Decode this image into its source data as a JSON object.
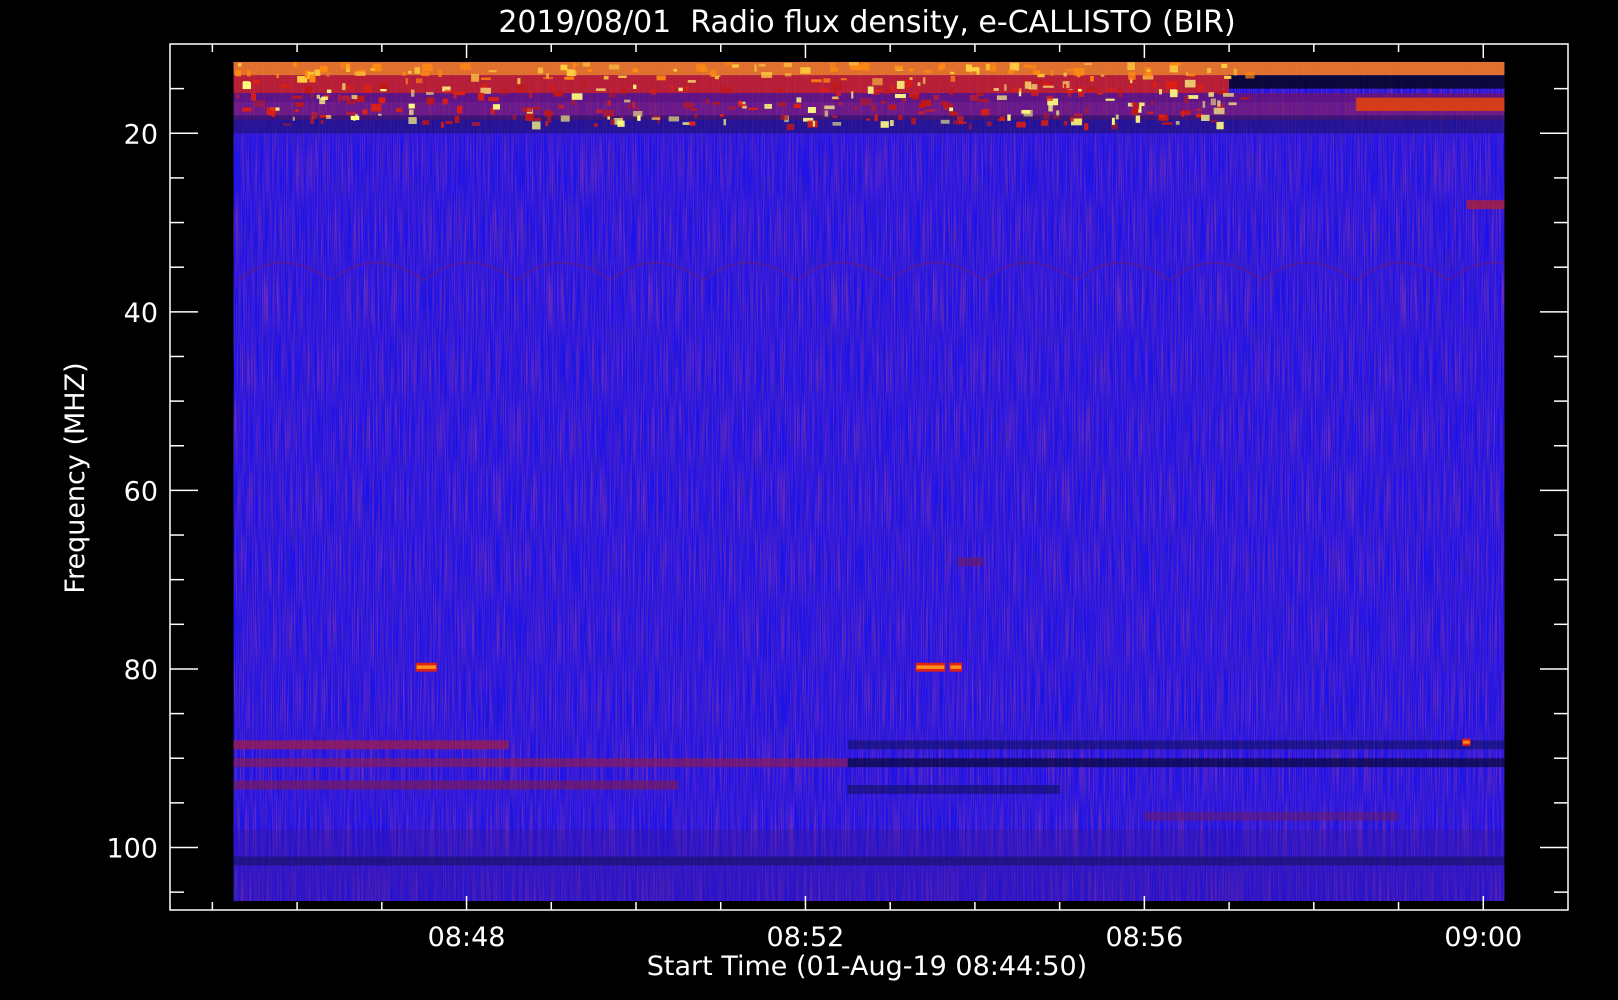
{
  "chart_data": {
    "type": "heatmap",
    "title": "2019/08/01  Radio flux density, e-CALLISTO (BIR)",
    "xlabel": "Start Time (01-Aug-19 08:44:50)",
    "ylabel": "Frequency (MHZ)",
    "x_ticks": [
      "08:48",
      "08:52",
      "08:56",
      "09:00"
    ],
    "y_ticks": [
      "20",
      "40",
      "60",
      "80",
      "100"
    ],
    "x_range_minutes": [
      44.5,
      61.0
    ],
    "data_range_minutes": [
      45.25,
      60.25
    ],
    "y_range_mhz": [
      10,
      107
    ],
    "data_range_mhz": [
      12,
      106
    ],
    "background_color": "#1a10f0",
    "colormap": [
      "#000010",
      "#1a10f0",
      "#8a1a60",
      "#e0200a",
      "#ff8a10",
      "#ffff70"
    ],
    "bands": [
      {
        "y0": 12.0,
        "y1": 13.5,
        "t0": 45.25,
        "t1": 60.25,
        "color": "#ff8010",
        "opacity": 0.85
      },
      {
        "y0": 13.5,
        "y1": 15.5,
        "t0": 45.25,
        "t1": 57.0,
        "color": "#d82010",
        "opacity": 0.8
      },
      {
        "y0": 15.5,
        "y1": 16.5,
        "t0": 45.25,
        "t1": 60.25,
        "color": "#6a1470",
        "opacity": 0.8
      },
      {
        "y0": 16.5,
        "y1": 18.5,
        "t0": 45.25,
        "t1": 60.25,
        "color": "#8a1c60",
        "opacity": 0.65
      },
      {
        "y0": 18.0,
        "y1": 20.0,
        "t0": 45.25,
        "t1": 60.25,
        "color": "#20106a",
        "opacity": 0.6
      },
      {
        "y0": 16.0,
        "y1": 17.5,
        "t0": 58.5,
        "t1": 60.25,
        "color": "#e04010",
        "opacity": 0.9
      },
      {
        "y0": 13.5,
        "y1": 15.0,
        "t0": 57.0,
        "t1": 60.25,
        "color": "#050520",
        "opacity": 0.85
      },
      {
        "y0": 88.0,
        "y1": 89.0,
        "t0": 45.25,
        "t1": 48.5,
        "color": "#9a1c50",
        "opacity": 0.8
      },
      {
        "y0": 90.0,
        "y1": 91.0,
        "t0": 45.25,
        "t1": 52.5,
        "color": "#8a1a5a",
        "opacity": 0.7
      },
      {
        "y0": 92.5,
        "y1": 93.5,
        "t0": 45.25,
        "t1": 50.5,
        "color": "#7a1a5a",
        "opacity": 0.7
      },
      {
        "y0": 88.0,
        "y1": 89.0,
        "t0": 52.5,
        "t1": 60.25,
        "color": "#101060",
        "opacity": 0.6
      },
      {
        "y0": 90.0,
        "y1": 91.0,
        "t0": 52.5,
        "t1": 60.25,
        "color": "#0a0a40",
        "opacity": 0.75
      },
      {
        "y0": 93.0,
        "y1": 94.0,
        "t0": 52.5,
        "t1": 55.0,
        "color": "#101060",
        "opacity": 0.6
      },
      {
        "y0": 96.0,
        "y1": 97.0,
        "t0": 56.0,
        "t1": 59.0,
        "color": "#6a1a6a",
        "opacity": 0.55
      },
      {
        "y0": 98.0,
        "y1": 106.0,
        "t0": 45.25,
        "t1": 60.25,
        "color": "#3a1498",
        "opacity": 0.35
      },
      {
        "y0": 101.0,
        "y1": 102.0,
        "t0": 45.25,
        "t1": 60.25,
        "color": "#101050",
        "opacity": 0.5
      },
      {
        "y0": 27.5,
        "y1": 28.5,
        "t0": 59.8,
        "t1": 60.25,
        "color": "#c02020",
        "opacity": 0.7
      },
      {
        "y0": 67.5,
        "y1": 68.5,
        "t0": 53.8,
        "t1": 54.1,
        "color": "#6a1a6a",
        "opacity": 0.7
      }
    ],
    "bursts": [
      {
        "t0": 47.4,
        "t1": 47.65,
        "y0": 79.3,
        "y1": 80.3
      },
      {
        "t0": 53.3,
        "t1": 53.65,
        "y0": 79.3,
        "y1": 80.3
      },
      {
        "t0": 53.7,
        "t1": 53.85,
        "y0": 79.3,
        "y1": 80.3
      },
      {
        "t0": 59.75,
        "t1": 59.85,
        "y0": 87.8,
        "y1": 88.6
      }
    ]
  }
}
